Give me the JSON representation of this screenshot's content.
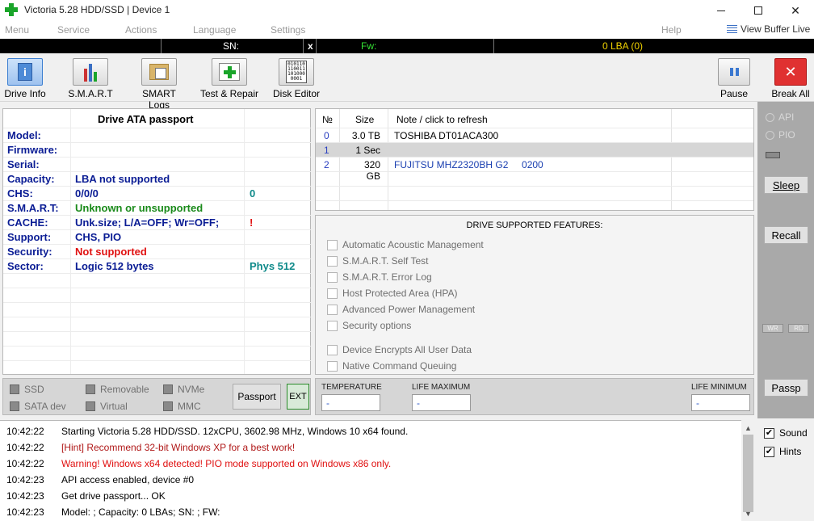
{
  "window": {
    "title": "Victoria 5.28 HDD/SSD | Device 1"
  },
  "menu": {
    "items": [
      "Menu",
      "Service",
      "Actions",
      "Language",
      "Settings"
    ],
    "help": "Help",
    "view_buffer": "View Buffer Live"
  },
  "status_bar": {
    "sn_label": "SN:",
    "close": "x",
    "fw_label": "Fw:",
    "lba": "0 LBA (0)"
  },
  "toolbar": {
    "drive_info": "Drive Info",
    "smart": "S.M.A.R.T",
    "smart_logs": "SMART Logs",
    "test_repair": "Test & Repair",
    "disk_editor": "Disk Editor",
    "disk_editor_glyph": "010110\n110011\n101000\n0001",
    "pause": "Pause",
    "break_all": "Break All"
  },
  "passport": {
    "title": "Drive ATA passport",
    "rows": [
      {
        "label": "Model:",
        "value": "",
        "extra": ""
      },
      {
        "label": "Firmware:",
        "value": "",
        "extra": ""
      },
      {
        "label": "Serial:",
        "value": "",
        "extra": ""
      },
      {
        "label": "Capacity:",
        "value": "LBA not supported",
        "extra": ""
      },
      {
        "label": "CHS:",
        "value": "0/0/0",
        "extra": "0"
      },
      {
        "label": "S.M.A.R.T:",
        "value": "Unknown or unsupported",
        "extra": ""
      },
      {
        "label": "CACHE:",
        "value": "Unk.size; L/A=OFF; Wr=OFF;",
        "extra": "!"
      },
      {
        "label": "Support:",
        "value": "CHS, PIO",
        "extra": ""
      },
      {
        "label": "Security:",
        "value": "Not supported",
        "extra": ""
      },
      {
        "label": "Sector:",
        "value": "Logic 512 bytes",
        "extra": "Phys 512"
      }
    ],
    "colors": {
      "label": "#0a1c94",
      "value": "#0a1c94",
      "smart_value": "#1a8a1a",
      "security_value": "#e01010",
      "extra_teal": "#0f8a8a",
      "extra_red": "#e01010"
    }
  },
  "options": {
    "ssd": "SSD",
    "removable": "Removable",
    "nvme": "NVMe",
    "sata_dev": "SATA dev",
    "virtual": "Virtual",
    "mmc": "MMC",
    "passport_button": "Passport",
    "ext_button": "EXT"
  },
  "devices": {
    "headers": {
      "num": "№",
      "size": "Size",
      "note": "Note / click to refresh"
    },
    "rows": [
      {
        "num": "0",
        "size": "3.0 TB",
        "note": "TOSHIBA DT01ACA300",
        "selected": false
      },
      {
        "num": "1",
        "size": "1 Sec",
        "note": "",
        "selected": true
      },
      {
        "num": "2",
        "size": "320 GB",
        "note": "FUJITSU MHZ2320BH G2     0200",
        "selected": false
      }
    ]
  },
  "features": {
    "title": "DRIVE SUPPORTED FEATURES:",
    "items": [
      "Automatic Acoustic Management",
      "S.M.A.R.T. Self Test",
      "S.M.A.R.T. Error Log",
      "Host Protected Area (HPA)",
      "Advanced Power Management",
      "Security options",
      "Device Encrypts All User Data",
      "Native Command Queuing"
    ]
  },
  "temps": {
    "temperature_label": "TEMPERATURE",
    "temperature_value": "-",
    "life_max_label": "LIFE MAXIMUM",
    "life_max_value": "-",
    "life_min_label": "LIFE MINIMUM",
    "life_min_value": "-"
  },
  "right_panel": {
    "api": "API",
    "pio": "PIO",
    "sleep": "Sleep",
    "recall": "Recall",
    "wr": "WR",
    "rd": "RD",
    "passp": "Passp"
  },
  "log": {
    "lines": [
      {
        "time": "10:42:22",
        "text": "Starting Victoria 5.28 HDD/SSD. 12xCPU, 3602.98 MHz, Windows 10 x64 found.",
        "color": "#000000"
      },
      {
        "time": "10:42:22",
        "text": "[Hint] Recommend 32-bit Windows XP for a best work!",
        "color": "#b01818"
      },
      {
        "time": "10:42:22",
        "text": "Warning! Windows x64 detected! PIO mode supported on Windows x86 only.",
        "color": "#e01010"
      },
      {
        "time": "10:42:23",
        "text": "API access enabled, device #0",
        "color": "#000000"
      },
      {
        "time": "10:42:23",
        "text": "Get drive passport... OK",
        "color": "#000000"
      },
      {
        "time": "10:42:23",
        "text": "Model:  ; Capacity: 0 LBAs; SN:  ; FW:",
        "color": "#000000"
      }
    ]
  },
  "bottom_right": {
    "sound": "Sound",
    "hints": "Hints"
  }
}
